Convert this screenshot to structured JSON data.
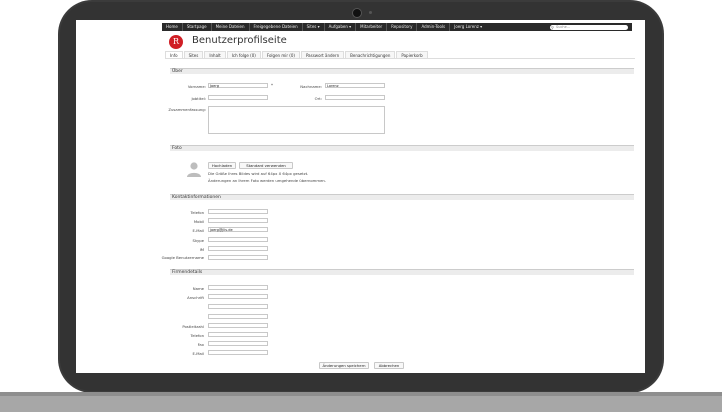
{
  "nav": [
    "Home",
    "Startpage",
    "Meine Dateien",
    "Freigegebene Dateien",
    "Sites ▾",
    "Aufgaben ▾",
    "Mitarbeiter",
    "Repository",
    "Admin-Tools",
    "Joerg Lorenz ▾"
  ],
  "search": {
    "placeholder": "Suche..."
  },
  "page": {
    "title": "Benutzerprofilseite",
    "logo_letter": "R"
  },
  "tabs": [
    "Info",
    "Sites",
    "Inhalt",
    "Ich folge (0)",
    "Folgen mir (0)",
    "Passwort ändern",
    "Benachrichtigungen",
    "Papierkorb"
  ],
  "about": {
    "heading": "Über",
    "firstname_label": "Vorname:",
    "firstname_value": "Joerg",
    "lastname_label": "Nachname:",
    "lastname_value": "Lorenz",
    "jobtitle_label": "Jobtitel:",
    "location_label": "Ort:",
    "summary_label": "Zusammenfassung:",
    "required_mark": "*"
  },
  "photo": {
    "heading": "Foto",
    "upload_label": "Hochladen",
    "default_label": "Standard verwenden",
    "note1": "Die Größe Ihres Bildes wird auf 64px X 64px gesetzt.",
    "note2": "Änderungen an Ihrem Foto werden umgehende übernommen."
  },
  "contact": {
    "heading": "Kontaktinformationen",
    "fields": [
      {
        "label": "Telefon",
        "value": ""
      },
      {
        "label": "Mobil",
        "value": ""
      },
      {
        "label": "E-Mail",
        "value": "joerg@jlis.de"
      },
      {
        "label": "Skype",
        "value": ""
      },
      {
        "label": "IM",
        "value": ""
      },
      {
        "label": "Google Benutzername",
        "value": ""
      }
    ]
  },
  "company": {
    "heading": "Firmendetails",
    "name_label": "Name",
    "address_label": "Anschrift",
    "zip_label": "Postleitzahl",
    "phone_label": "Telefon",
    "fax_label": "Fax",
    "email_label": "E-Mail"
  },
  "actions": {
    "save_label": "Änderungen speichern",
    "cancel_label": "Abbrechen"
  }
}
